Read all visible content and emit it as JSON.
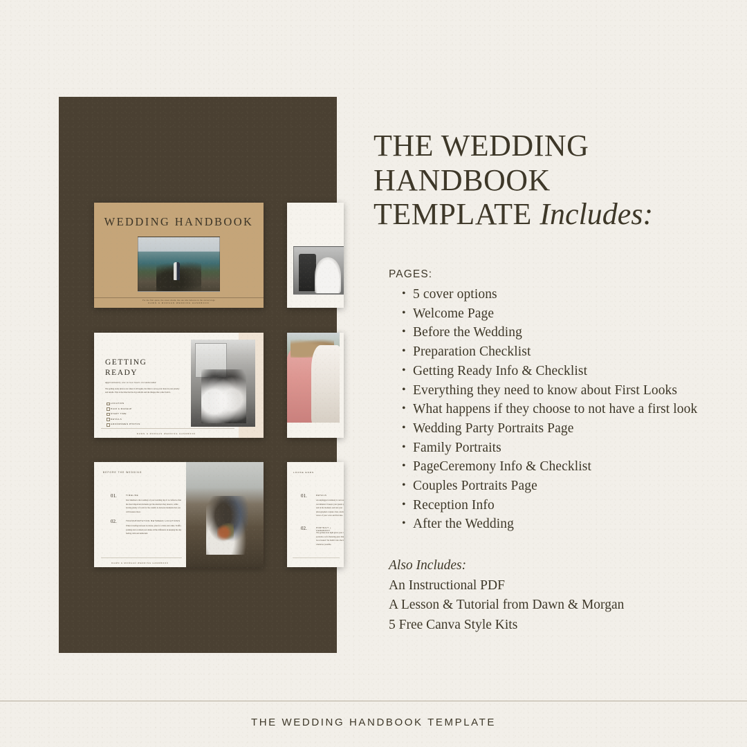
{
  "theme": {
    "background": "#F2EFE9",
    "panel_brown": "#4A4032",
    "cover_tan": "#C5A579",
    "text_dark": "#3D3728",
    "rule": "#B5AC9C",
    "page_white": "#F6F3ED",
    "band_beige": "#EFE3D4"
  },
  "headline": {
    "line1": "THE WEDDING",
    "line2": "HANDBOOK",
    "line3_regular": "TEMPLATE ",
    "line3_italic": "Includes:"
  },
  "pages_section": {
    "label": "PAGES:",
    "items": [
      "5 cover options",
      "Welcome Page",
      "Before the Wedding",
      "Preparation Checklist",
      "Getting Ready Info & Checklist",
      "Everything they need to know about First Looks",
      "What happens if they choose to not have a first look",
      "Wedding Party Portraits Page",
      "Family Portraits",
      "PageCeremony Info & Checklist",
      "Couples Portraits Page",
      "Reception Info",
      "After the Wedding"
    ]
  },
  "also_includes": {
    "title": "Also Includes:",
    "lines": [
      "An Instructional PDF",
      "A Lesson & Tutorial from Dawn & Morgan",
      "5 Free Canva Style Kits"
    ]
  },
  "footer": {
    "text": "THE WEDDING HANDBOOK TEMPLATE"
  },
  "mockups": {
    "cover": {
      "title": "WEDDING HANDBOOK",
      "caption": "For the first quote, the sweet charm, the one who believes in the curved stage",
      "footer": "DAWN & MORGAN WEDDING HANDBOOK",
      "photo_alt": "couple-on-coastal-cliff-photo"
    },
    "getting_ready": {
      "title_line1": "GETTING",
      "title_line2": "READY",
      "subtitle": "Approximately one to two hours recommended",
      "body": "The getting ready photos are where it all begins, the time to set up your dress in your jewelry and details. This is the time that the day unfolds and the images that come from it.",
      "checklist": [
        "LOCATION",
        "HAIR & MAKEUP",
        "START TIME",
        "DETAILS",
        "GROOMSMEN PHOTOS"
      ],
      "footer": "DAWN & MORGAN WEDDING HANDBOOK",
      "photo_alt": "bride-getting-ready-mirror-bw-photo"
    },
    "before_wedding": {
      "header": "BEFORE THE WEDDING",
      "items": [
        {
          "number": "01.",
          "title": "TIMELINE",
          "text": "Our timeline is the roadmap of your wedding day. It is crafted so that the most important moments get the attention they deserve, while leaving plenty of room for the candid, in-between moments that you will treasure most."
        },
        {
          "number": "02.",
          "title": "TRANSPORTATION BETWEEN LOCATIONS",
          "text": "When traveling between locations, plan for a little extra time. Traffic, parking and a relaxed pace make all the difference in keeping the day feeling calm and unhurried."
        }
      ],
      "footer": "DAWN & MORGAN WEDDING HANDBOOK",
      "photo_alt": "couple-sitting-on-lava-field-photo"
    },
    "right_column": [
      {
        "name": "first-dance-page",
        "photo_alt": "first-dance-black-and-white-photo"
      },
      {
        "name": "wedding-party-page",
        "photo_alt": "bridesmaids-in-pink-dresses-photo"
      },
      {
        "name": "details-text-page",
        "header": "LOOSE ENDS",
        "items": [
          {
            "number": "01.",
            "title": "DETAILS",
            "text": "An unplugged ceremony is our reason we recommend. It keeps your guests present and in the moment, and lets your photographers capture clear, unobstructed views of your vows and first kiss."
          },
          {
            "number": "02.",
            "title": "PORTRAIT + CEREMONY",
            "text": "The golden hour light gives your couples portraits a soft, flattering glow that cannot be recreated. We build it into the timeline whenever possible."
          }
        ]
      }
    ]
  }
}
